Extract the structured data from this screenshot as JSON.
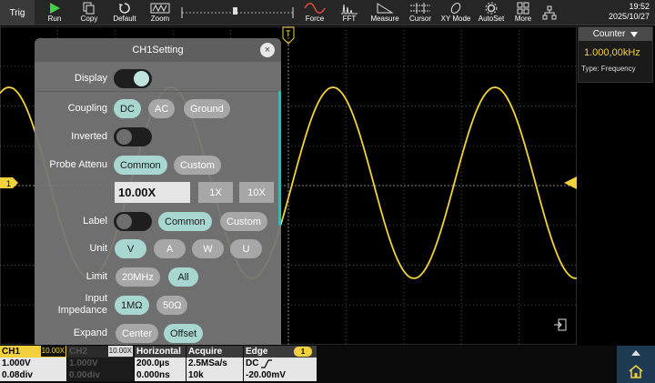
{
  "toolbar": {
    "trig": "Trig",
    "run": "Run",
    "copy": "Copy",
    "default": "Default",
    "zoom": "Zoom",
    "force": "Force",
    "fft": "FFT",
    "measure": "Measure",
    "cursor": "Cursor",
    "xymode": "XY Mode",
    "autoset": "AutoSet",
    "more": "More"
  },
  "clock": {
    "time": "19:52",
    "date": "2025/10/27"
  },
  "counter": {
    "title": "Counter",
    "value": "1.000,00kHz",
    "type": "Type: Frequency"
  },
  "dialog": {
    "title": "CH1Setting",
    "close": "×",
    "display": {
      "label": "Display",
      "state": "on"
    },
    "coupling": {
      "label": "Coupling",
      "options": [
        "DC",
        "AC",
        "Ground"
      ],
      "selected": "DC"
    },
    "inverted": {
      "label": "Inverted",
      "state": "off"
    },
    "probe": {
      "label": "Probe Attenu",
      "options": [
        "Common",
        "Custom"
      ],
      "selected": "Common",
      "value": "10.00X",
      "quick": [
        "1X",
        "10X"
      ]
    },
    "label_row": {
      "label": "Label",
      "state": "off",
      "options": [
        "Common",
        "Custom"
      ],
      "selected": "Common"
    },
    "unit": {
      "label": "Unit",
      "options": [
        "V",
        "A",
        "W",
        "U"
      ],
      "selected": "V"
    },
    "limit": {
      "label": "Limit",
      "options": [
        "20MHz",
        "All"
      ],
      "selected": "All"
    },
    "impedance": {
      "label": "Input\nImpedance",
      "options": [
        "1MΩ",
        "50Ω"
      ],
      "selected": "1MΩ"
    },
    "expand": {
      "label": "Expand",
      "options": [
        "Center",
        "Offset"
      ],
      "selected": "Offset"
    }
  },
  "status": {
    "ch1": {
      "name": "CH1",
      "probe": "10.00X",
      "volts": "1.000V",
      "offset": "0.08div"
    },
    "ch2": {
      "name": "CH2",
      "probe": "10.00X",
      "volts": "1.000V",
      "offset": "0.00div"
    },
    "horizontal": {
      "title": "Horizontal",
      "timebase": "200.0µs",
      "delay": "0.000ns"
    },
    "acquire": {
      "title": "Acquire",
      "rate": "2.5MSa/s",
      "depth": "10k"
    },
    "edge": {
      "title": "Edge",
      "badge": "1",
      "coupling": "DC",
      "level": "-20.00mV"
    }
  },
  "markers": {
    "ch1": "1",
    "trigger_pos": "T"
  },
  "colors": {
    "ch1": "#f2d23c",
    "accent": "#a7d7d0",
    "home": "#1d3a52"
  },
  "waveform": {
    "channel": "CH1",
    "shape": "sine",
    "frequency_khz": 1.0
  }
}
